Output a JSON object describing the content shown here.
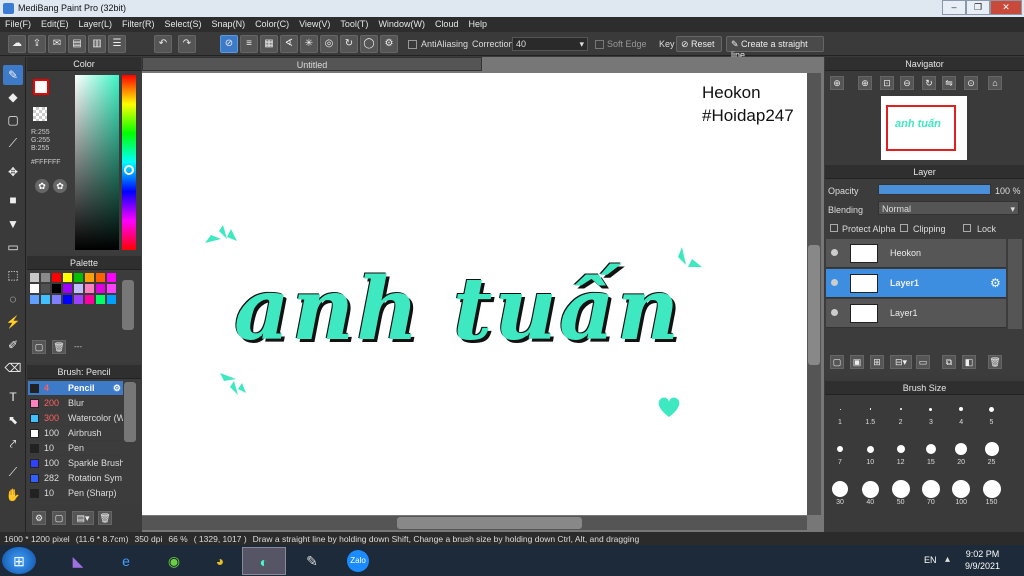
{
  "window": {
    "title": "MediBang Paint Pro (32bit)",
    "min": "–",
    "max": "❐",
    "close": "✕"
  },
  "menu": [
    "File(F)",
    "Edit(E)",
    "Layer(L)",
    "Filter(R)",
    "Select(S)",
    "Snap(N)",
    "Color(C)",
    "View(V)",
    "Tool(T)",
    "Window(W)",
    "Cloud",
    "Help"
  ],
  "toolbar": {
    "antialiasing": "AntiAliasing",
    "correction_label": "Correction",
    "correction_value": "40",
    "soft_edge": "Soft Edge",
    "key": "Key",
    "reset": "Reset",
    "straight_line": "Create a straight line"
  },
  "color_panel": {
    "title": "Color",
    "r": "R:255",
    "g": "G:255",
    "b": "B:255",
    "hex": "#FFFFFF"
  },
  "palette": {
    "title": "Palette",
    "colors": [
      "#c8c8c8",
      "#8a8a8a",
      "#ff0000",
      "#ffff00",
      "#00c000",
      "#ffa000",
      "#ff6000",
      "#ff00ff",
      "#ffffff",
      "#505050",
      "#000000",
      "#a000ff",
      "#c0c0ff",
      "#ff80c0",
      "#e000e0",
      "#ff40ff",
      "#60a0ff",
      "#40c0ff",
      "#8080ff",
      "#0000ff",
      "#a040ff",
      "#ff00a0",
      "#00ff60",
      "#00a0ff"
    ],
    "dash": "---"
  },
  "brush": {
    "title": "Brush: Pencil",
    "items": [
      {
        "size": "4",
        "name": "Pencil",
        "color": "#222222"
      },
      {
        "size": "200",
        "name": "Blur",
        "color": "#ff80c0"
      },
      {
        "size": "300",
        "name": "Watercolor (W",
        "color": "#40c0ff"
      },
      {
        "size": "100",
        "name": "Airbrush",
        "color": "#ffffff"
      },
      {
        "size": "10",
        "name": "Pen",
        "color": "#222222"
      },
      {
        "size": "100",
        "name": "Sparkle Brush",
        "color": "#3040ff"
      },
      {
        "size": "282",
        "name": "Rotation Sym",
        "color": "#3060ff"
      },
      {
        "size": "10",
        "name": "Pen (Sharp)",
        "color": "#222222"
      }
    ]
  },
  "document": {
    "tab": "Untitled",
    "text_name": "Heokon",
    "text_tag": "#Hoidap247",
    "lettering": "anh tuấn",
    "accent": "#3ee8c0"
  },
  "navigator": {
    "title": "Navigator"
  },
  "layer_panel": {
    "title": "Layer",
    "opacity_label": "Opacity",
    "opacity_value": "100 %",
    "blending_label": "Blending",
    "blending_value": "Normal",
    "protect_alpha": "Protect Alpha",
    "clipping": "Clipping",
    "lock": "Lock",
    "layers": [
      {
        "name": "Heokon",
        "selected": false
      },
      {
        "name": "Layer1",
        "selected": true
      },
      {
        "name": "Layer1",
        "selected": false
      }
    ]
  },
  "brush_size": {
    "title": "Brush Size",
    "sizes": [
      "1",
      "1.5",
      "2",
      "3",
      "4",
      "5",
      "7",
      "10",
      "12",
      "15",
      "20",
      "25",
      "30",
      "40",
      "50",
      "70",
      "100",
      "150"
    ]
  },
  "status": {
    "dims": "1600 * 1200 pixel",
    "cm": "(11.6 * 8.7cm)",
    "dpi": "350 dpi",
    "zoom": "66 %",
    "coords": "( 1329, 1017 )",
    "hint": "Draw a straight line by holding down Shift, Change a brush size by holding down Ctrl, Alt, and dragging"
  },
  "taskbar": {
    "lang": "EN",
    "time": "9:02 PM",
    "date": "9/9/2021",
    "zalo": "Zalo"
  }
}
